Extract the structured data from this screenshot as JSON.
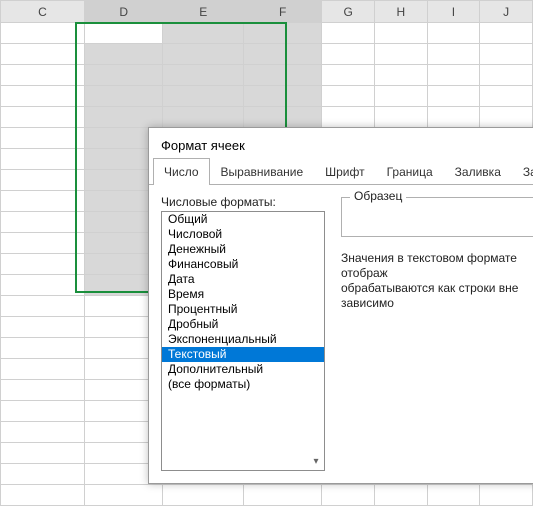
{
  "sheet": {
    "column_headers": [
      "C",
      "D",
      "E",
      "F",
      "G",
      "H",
      "I",
      "J"
    ]
  },
  "dialog": {
    "title": "Формат ячеек",
    "tabs": {
      "number": "Число",
      "alignment": "Выравнивание",
      "font": "Шрифт",
      "border": "Граница",
      "fill": "Заливка",
      "protection": "Защита"
    },
    "category_label": "Числовые форматы:",
    "categories": [
      "Общий",
      "Числовой",
      "Денежный",
      "Финансовый",
      "Дата",
      "Время",
      "Процентный",
      "Дробный",
      "Экспоненциальный",
      "Текстовый",
      "Дополнительный",
      "(все форматы)"
    ],
    "selected_category_index": 9,
    "sample_label": "Образец",
    "description": "Значения в текстовом формате отображ\nобрабатываются как строки вне зависимо"
  }
}
